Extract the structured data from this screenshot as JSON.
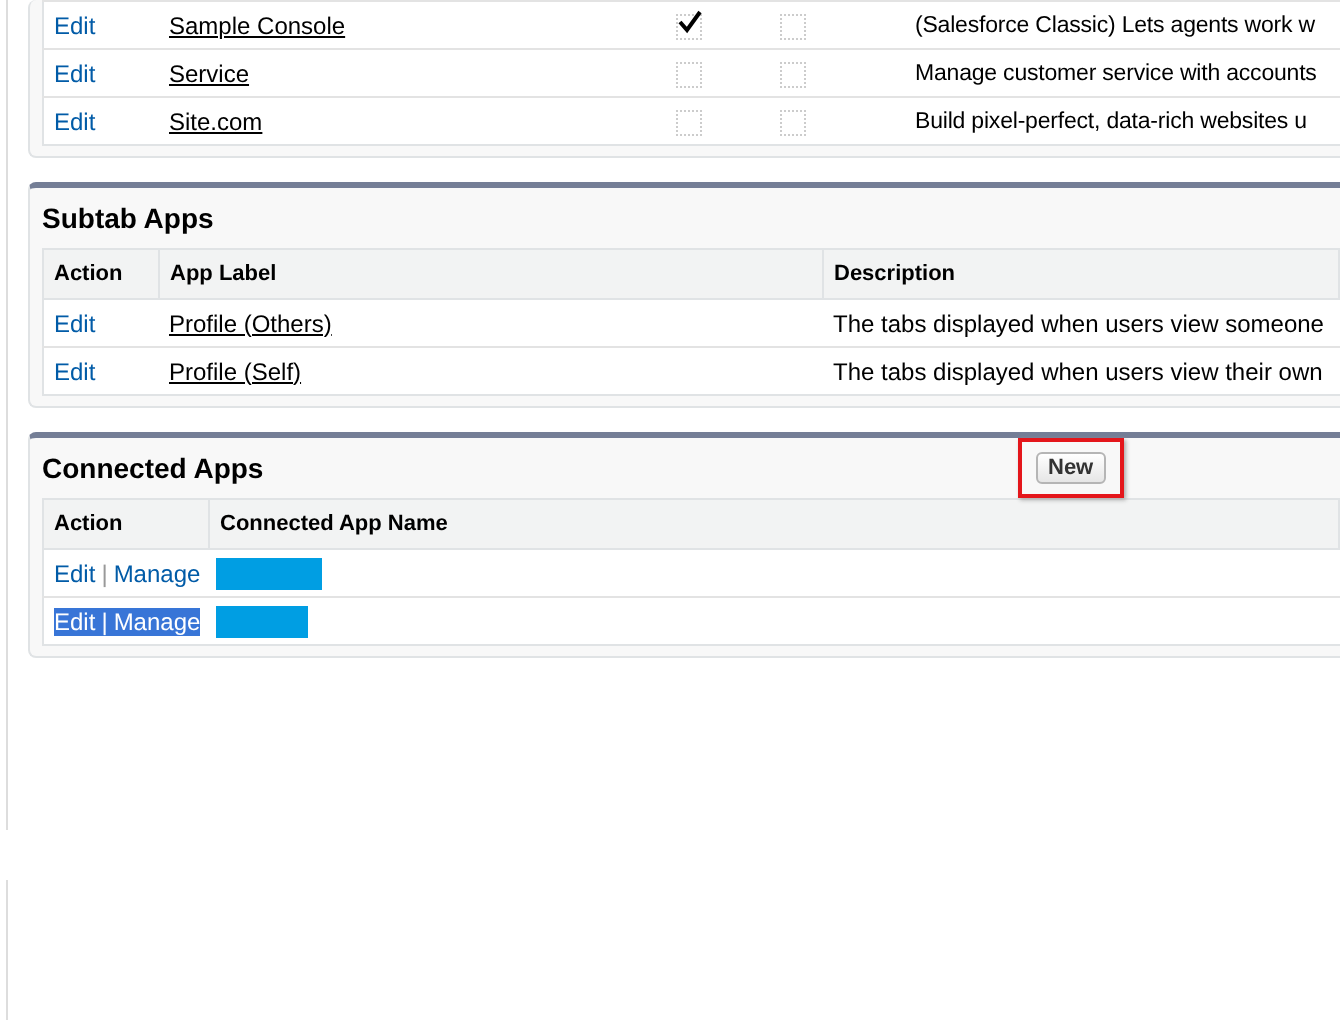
{
  "apps_table": {
    "rows": [
      {
        "action": "Edit",
        "label": "Sample Console",
        "check_1": true,
        "check_2": false,
        "description": "(Salesforce Classic) Lets agents work w"
      },
      {
        "action": "Edit",
        "label": "Service",
        "check_1": false,
        "check_2": false,
        "description": "Manage customer service with accounts"
      },
      {
        "action": "Edit",
        "label": "Site.com",
        "check_1": false,
        "check_2": false,
        "description": "Build pixel-perfect, data-rich websites u"
      }
    ]
  },
  "subtab_apps": {
    "title": "Subtab Apps",
    "columns": [
      "Action",
      "App Label",
      "Description"
    ],
    "rows": [
      {
        "action": "Edit",
        "label": "Profile (Others)",
        "description": "The tabs displayed when users view someone"
      },
      {
        "action": "Edit",
        "label": "Profile (Self)",
        "description": "The tabs displayed when users view their own"
      }
    ]
  },
  "connected_apps": {
    "title": "Connected Apps",
    "new_button": {
      "label": "New",
      "highlighted": true
    },
    "columns": [
      "Action",
      "Connected App Name"
    ],
    "rows": [
      {
        "edit": "Edit",
        "separator": "|",
        "manage": "Manage",
        "selected": false
      },
      {
        "edit": "Edit",
        "separator": "|",
        "manage": "Manage",
        "selected": true
      }
    ]
  }
}
